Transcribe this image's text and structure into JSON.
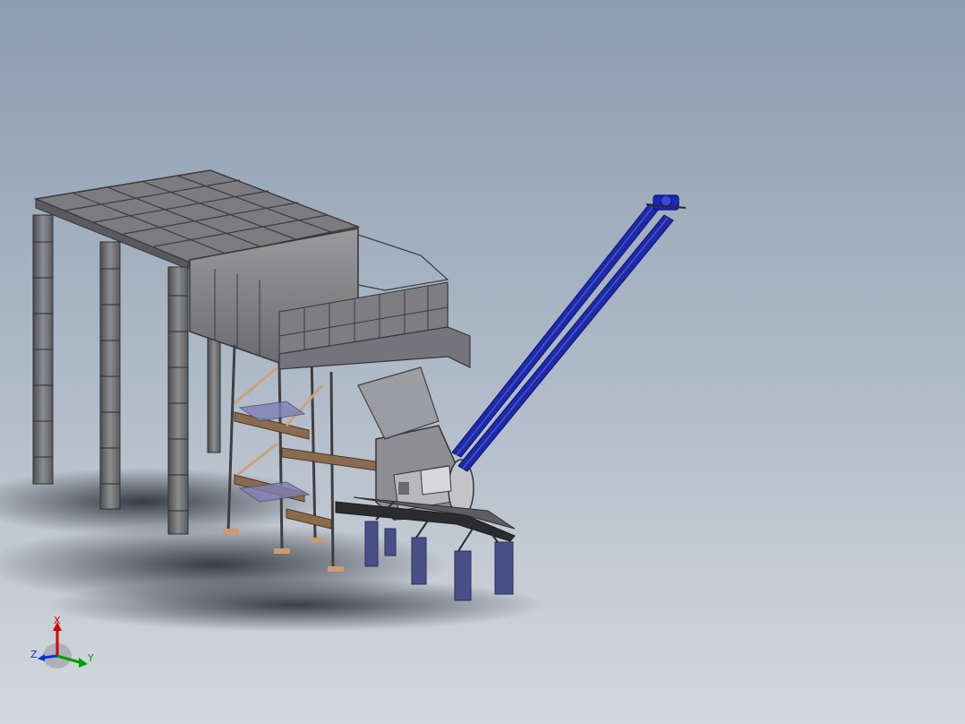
{
  "viewport": {
    "background_top": "#8c9db0",
    "background_bottom": "#d3d8de"
  },
  "model": {
    "frame_color": "#6e6e70",
    "beam_color": "#8a6b4e",
    "brace_color": "#c9a27a",
    "conveyor_color": "#1f2aa8",
    "base_color": "#4a4f8a",
    "shadow_color": "#2a2e36"
  },
  "triad": {
    "x_label": "X",
    "y_label": "Y",
    "z_label": "Z",
    "x_color": "#d40000",
    "y_color": "#00a000",
    "z_color": "#1030d0"
  }
}
